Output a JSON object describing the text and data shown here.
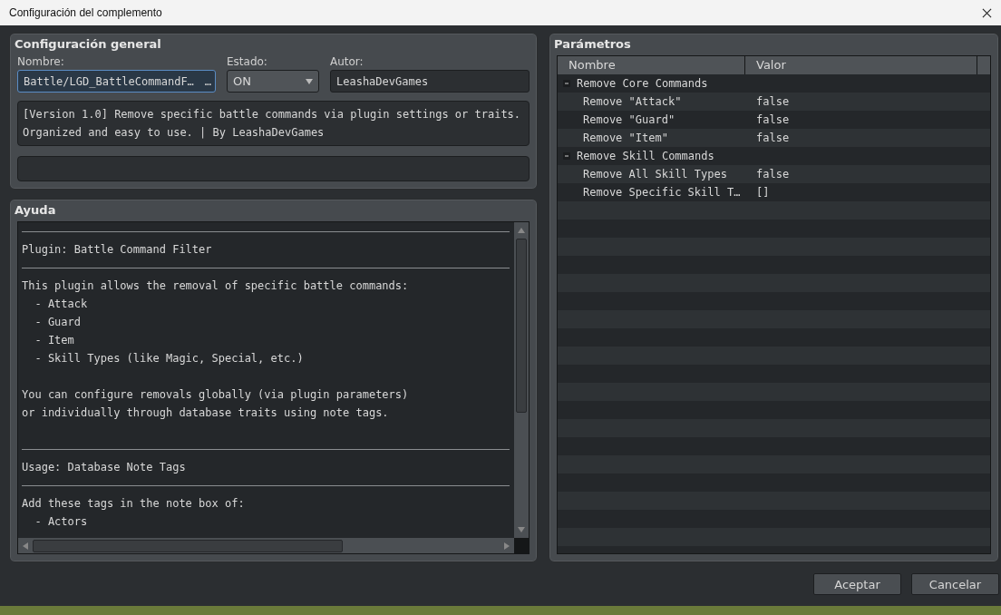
{
  "window": {
    "title": "Configuración del complemento"
  },
  "general": {
    "title": "Configuración general",
    "name_label": "Nombre:",
    "name_value": "Battle/LGD_BattleCommandF…",
    "name_button": "…",
    "name_focused": true,
    "state_label": "Estado:",
    "state_value": "ON",
    "author_label": "Autor:",
    "author_value": "LeashaDevGames",
    "description": "[Version 1.0] Remove specific battle commands via plugin settings or traits.\nOrganized and easy to use. | By LeashaDevGames"
  },
  "help": {
    "title": "Ayuda",
    "lines": [
      {
        "kind": "rule"
      },
      {
        "kind": "text",
        "text": "Plugin: Battle Command Filter"
      },
      {
        "kind": "rule"
      },
      {
        "kind": "text",
        "text": "This plugin allows the removal of specific battle commands:"
      },
      {
        "kind": "text",
        "text": "  - Attack"
      },
      {
        "kind": "text",
        "text": "  - Guard"
      },
      {
        "kind": "text",
        "text": "  - Item"
      },
      {
        "kind": "text",
        "text": "  - Skill Types (like Magic, Special, etc.)"
      },
      {
        "kind": "blank"
      },
      {
        "kind": "text",
        "text": "You can configure removals globally (via plugin parameters)"
      },
      {
        "kind": "text",
        "text": "or individually through database traits using note tags."
      },
      {
        "kind": "blank"
      },
      {
        "kind": "rule"
      },
      {
        "kind": "text",
        "text": "Usage: Database Note Tags"
      },
      {
        "kind": "rule"
      },
      {
        "kind": "text",
        "text": "Add these tags in the note box of:"
      },
      {
        "kind": "text",
        "text": "  - Actors"
      }
    ]
  },
  "parameters": {
    "title": "Parámetros",
    "columns": [
      "Nombre",
      "Valor"
    ],
    "groups": [
      {
        "name": "Remove Core Commands",
        "expanded": true,
        "children": [
          {
            "name": "Remove \"Attack\"",
            "value": "false"
          },
          {
            "name": "Remove \"Guard\"",
            "value": "false"
          },
          {
            "name": "Remove \"Item\"",
            "value": "false"
          }
        ]
      },
      {
        "name": "Remove Skill Commands",
        "expanded": true,
        "children": [
          {
            "name": "Remove All Skill Types",
            "value": "false"
          },
          {
            "name": "Remove Specific Skill T…",
            "value": "[]"
          }
        ]
      }
    ]
  },
  "buttons": [
    "Aceptar",
    "Cancelar"
  ]
}
